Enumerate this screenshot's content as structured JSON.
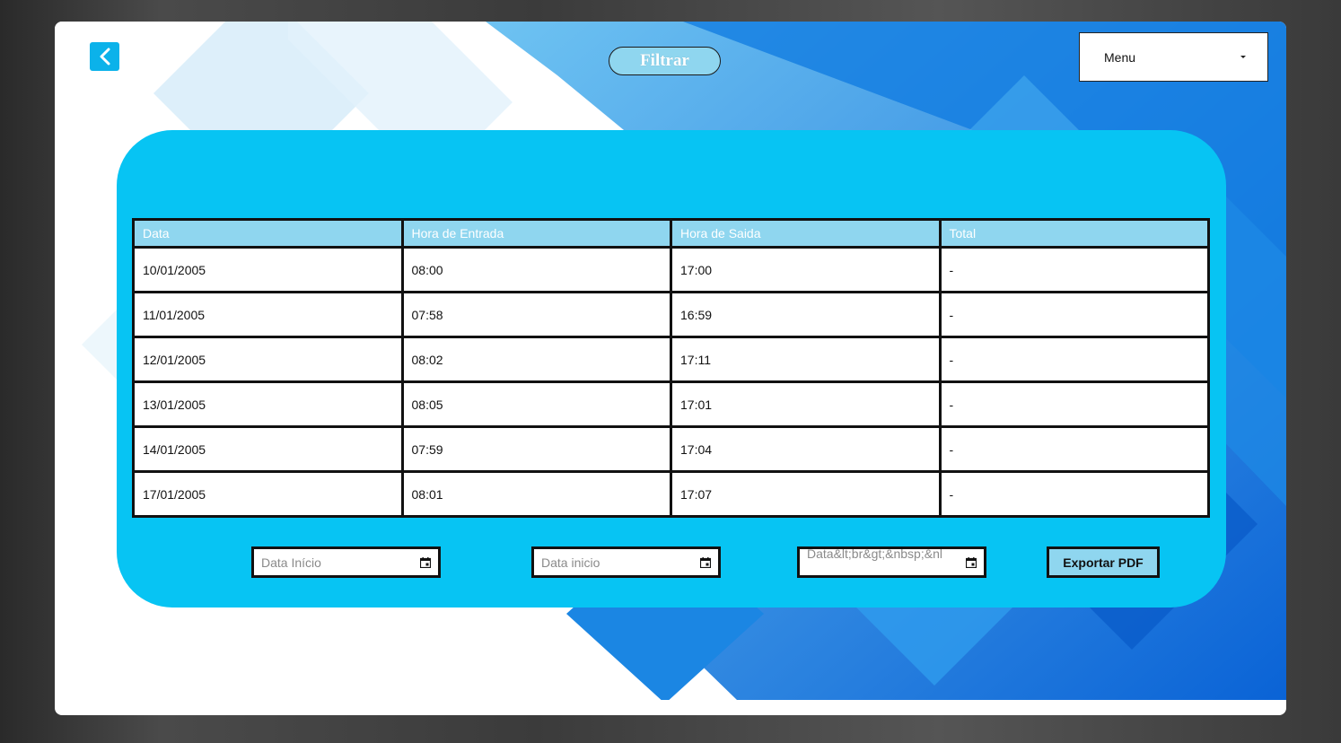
{
  "header": {
    "back_icon": "chevron-left-icon",
    "filter_label": "Filtrar",
    "menu_label": "Menu",
    "menu_icon": "caret-down-icon"
  },
  "table": {
    "columns": [
      "Data",
      "Hora de Entrada",
      "Hora de Saida",
      "Total"
    ],
    "rows": [
      [
        "10/01/2005",
        "08:00",
        "17:00",
        "-"
      ],
      [
        "11/01/2005",
        "07:58",
        "16:59",
        "-"
      ],
      [
        "12/01/2005",
        "08:02",
        "17:11",
        "-"
      ],
      [
        "13/01/2005",
        "08:05",
        "17:01",
        "-"
      ],
      [
        "14/01/2005",
        "07:59",
        "17:04",
        "-"
      ],
      [
        "17/01/2005",
        "08:01",
        "17:07",
        "-"
      ]
    ]
  },
  "filters": {
    "field1_placeholder": "Data Início",
    "field2_placeholder": "Data inicio",
    "field3_placeholder": "Data&lt;br&gt;&nbsp;&nbsp;",
    "calendar_icon": "calendar-icon",
    "export_label": "Exportar PDF"
  },
  "colors": {
    "accent": "#07c4f3",
    "header_cell": "#8fd6ef",
    "back_button": "#0bb2ea"
  }
}
